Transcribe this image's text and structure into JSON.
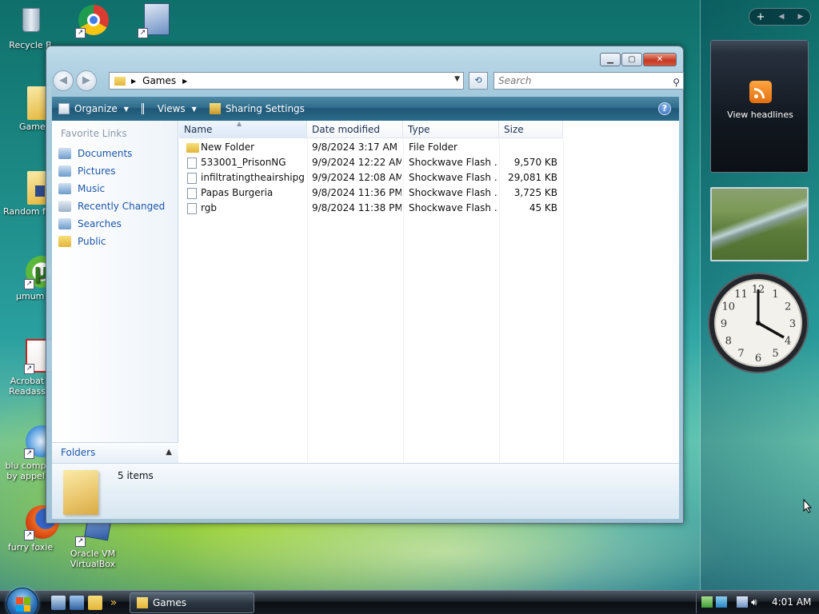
{
  "desktop": {
    "icons": [
      {
        "label": "Recycle B"
      },
      {
        "label": "Games"
      },
      {
        "label": "Random f"
      },
      {
        "label": "µmum"
      },
      {
        "label": "Acrobat Readass"
      },
      {
        "label": "blu comp by appel"
      },
      {
        "label": "furry foxie"
      },
      {
        "label": "Oracle VM VirtualBox"
      }
    ]
  },
  "sidebar": {
    "controls": {
      "add": "+",
      "prev": "◀",
      "next": "▶"
    },
    "feed_gadget": {
      "label": "View headlines"
    },
    "clock_numbers": [
      "12",
      "1",
      "2",
      "3",
      "4",
      "5",
      "6",
      "7",
      "8",
      "9",
      "10",
      "11"
    ]
  },
  "window": {
    "title": "",
    "address": {
      "crumb": "Games"
    },
    "search": {
      "placeholder": "Search"
    },
    "toolbar": {
      "organize": "Organize",
      "views": "Views",
      "sharing": "Sharing Settings"
    },
    "nav_pane": {
      "heading": "Favorite Links",
      "links": [
        "Documents",
        "Pictures",
        "Music",
        "Recently Changed",
        "Searches",
        "Public"
      ],
      "folders_label": "Folders"
    },
    "columns": [
      "Name",
      "Date modified",
      "Type",
      "Size"
    ],
    "files": [
      {
        "name": "New Folder",
        "date": "9/8/2024 3:17 AM",
        "type": "File Folder",
        "size": "",
        "is_folder": true
      },
      {
        "name": "533001_PrisonNG",
        "date": "9/9/2024 12:22 AM",
        "type": "Shockwave Flash ...",
        "size": "9,570 KB",
        "is_folder": false
      },
      {
        "name": "infiltratingtheairshipga...",
        "date": "9/9/2024 12:08 AM",
        "type": "Shockwave Flash ...",
        "size": "29,081 KB",
        "is_folder": false
      },
      {
        "name": "Papas Burgeria",
        "date": "9/8/2024 11:36 PM",
        "type": "Shockwave Flash ...",
        "size": "3,725 KB",
        "is_folder": false
      },
      {
        "name": "rgb",
        "date": "9/8/2024 11:38 PM",
        "type": "Shockwave Flash ...",
        "size": "45 KB",
        "is_folder": false
      }
    ],
    "details": {
      "count": "5 items"
    }
  },
  "taskbar": {
    "task": "Games",
    "clock": "4:01 AM"
  },
  "colors": {
    "link": "#1c56a8",
    "toolbar": "#2f6c8c",
    "close": "#c63a24"
  }
}
